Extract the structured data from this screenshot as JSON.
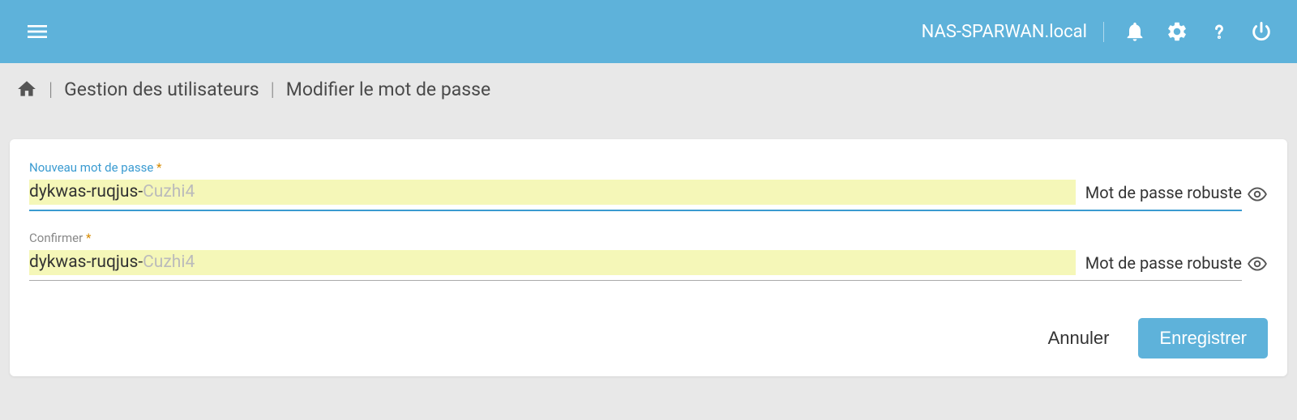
{
  "header": {
    "hostname": "NAS-SPARWAN.local"
  },
  "breadcrumb": {
    "user_management": "Gestion des utilisateurs",
    "change_password": "Modifier le mot de passe"
  },
  "form": {
    "new_password": {
      "label": "Nouveau mot de passe",
      "required_mark": "*",
      "value_visible": "dykwas-ruqjus-",
      "value_ghost": "Cuzhi4",
      "strength": "Mot de passe robuste"
    },
    "confirm": {
      "label": "Confirmer",
      "required_mark": "*",
      "value_visible": "dykwas-ruqjus-",
      "value_ghost": "Cuzhi4",
      "strength": "Mot de passe robuste"
    }
  },
  "actions": {
    "cancel": "Annuler",
    "save": "Enregistrer"
  }
}
